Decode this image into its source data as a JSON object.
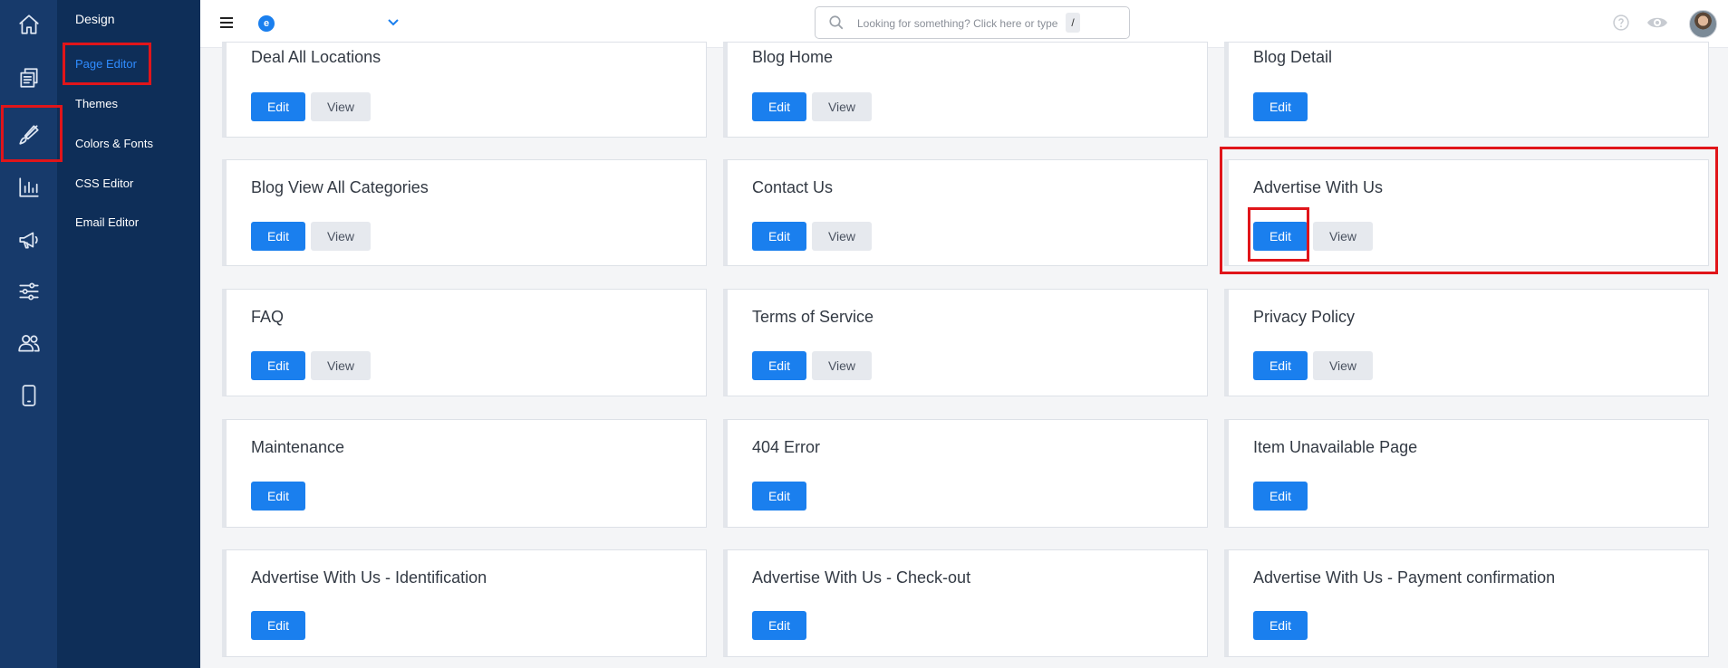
{
  "left_rail": {
    "icons": [
      "home-icon",
      "pages-icon",
      "brush-icon",
      "analytics-icon",
      "megaphone-icon",
      "sliders-icon",
      "users-icon",
      "mobile-icon"
    ]
  },
  "subnav": {
    "title": "Design",
    "items": [
      "Page Editor",
      "Themes",
      "Colors & Fonts",
      "CSS Editor",
      "Email Editor"
    ]
  },
  "topbar": {
    "logo_letter": "e",
    "search_placeholder": "Looking for something? Click here or type",
    "shortcut": "/"
  },
  "cards": [
    {
      "title": "Deal All Locations",
      "edit": "Edit",
      "view": "View"
    },
    {
      "title": "Blog Home",
      "edit": "Edit",
      "view": "View"
    },
    {
      "title": "Blog Detail",
      "edit": "Edit"
    },
    {
      "title": "Blog View All Categories",
      "edit": "Edit",
      "view": "View"
    },
    {
      "title": "Contact Us",
      "edit": "Edit",
      "view": "View"
    },
    {
      "title": "Advertise With Us",
      "edit": "Edit",
      "view": "View"
    },
    {
      "title": "FAQ",
      "edit": "Edit",
      "view": "View"
    },
    {
      "title": "Terms of Service",
      "edit": "Edit",
      "view": "View"
    },
    {
      "title": "Privacy Policy",
      "edit": "Edit",
      "view": "View"
    },
    {
      "title": "Maintenance",
      "edit": "Edit"
    },
    {
      "title": "404 Error",
      "edit": "Edit"
    },
    {
      "title": "Item Unavailable Page",
      "edit": "Edit"
    },
    {
      "title": "Advertise With Us - Identification",
      "edit": "Edit"
    },
    {
      "title": "Advertise With Us - Check-out",
      "edit": "Edit"
    },
    {
      "title": "Advertise With Us - Payment confirmation",
      "edit": "Edit"
    }
  ],
  "colors": {
    "rail": "#173a6b",
    "subnav": "#0e2e58",
    "accent": "#1a7fee",
    "highlight": "#e0151a"
  }
}
